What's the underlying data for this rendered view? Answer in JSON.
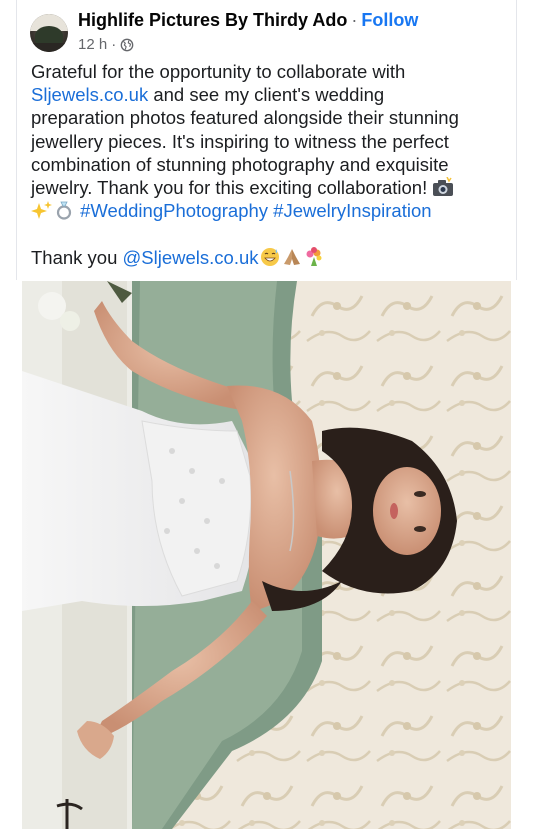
{
  "post": {
    "author": "Highlife Pictures By Thirdy Ado",
    "separator": "·",
    "follow_label": "Follow",
    "time": "12 h",
    "meta_sep": "·",
    "audience_icon": "globe-icon",
    "text": {
      "line1": "Grateful for the opportunity to collaborate with",
      "line2_link": "Sljewels.co.uk",
      "line2_rest": " and see my client's wedding",
      "line3": "preparation photos featured alongside their stunning",
      "line4": "jewellery pieces. It's inspiring to witness the perfect",
      "line5": "combination of stunning photography and exquisite",
      "line6": "jewelry. Thank you for this exciting collaboration!",
      "hashtag1": "#WeddingPhotography",
      "hashtag2": "#JewelryInspiration",
      "thanks_prefix": "Thank you ",
      "thanks_mention": "@Sljewels.co.uk"
    },
    "emojis": [
      "camera-flash-emoji",
      "sparkles-emoji",
      "ring-emoji",
      "grin-sweat-emoji",
      "folded-hands-emoji",
      "bouquet-emoji"
    ],
    "image": {
      "subject": "bride-photo"
    }
  },
  "colors": {
    "link": "#1a6ed8",
    "follow": "#1877f2",
    "meta": "#65676b"
  }
}
